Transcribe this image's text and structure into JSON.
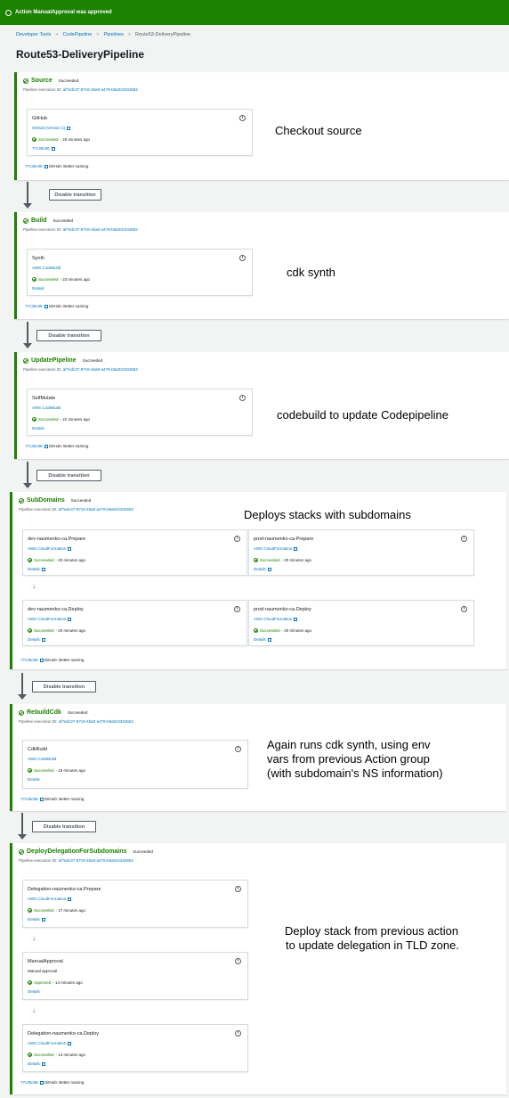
{
  "flash": {
    "text": "Action ManualApproval was approved"
  },
  "breadcrumb": [
    "Developer Tools",
    "CodePipeline",
    "Pipelines",
    "Route53-DeliveryPipeline"
  ],
  "page_title": "Route53-DeliveryPipeline",
  "common": {
    "exec_label": "Pipeline execution ID:",
    "exec_id": "af7edc37-87c8-4ba0-a478-b5a0cb334652",
    "commit_hash": "77c35c88",
    "commit_msg": "GitHub: Better naming",
    "disable_transition": "Disable transition",
    "details": "Details"
  },
  "stages": {
    "source": {
      "name": "Source",
      "status": "Succeeded",
      "action": {
        "name": "GitHub",
        "provider": "GitHub (Version 1)",
        "status": "Succeeded",
        "time": "- 25 minutes ago",
        "link": "77c35c88"
      }
    },
    "build": {
      "name": "Build",
      "status": "Succeeded",
      "action": {
        "name": "Synth",
        "provider": "AWS CodeBuild",
        "status": "Succeeded",
        "time": "- 23 minutes ago"
      }
    },
    "update": {
      "name": "UpdatePipeline",
      "status": "Succeeded",
      "action": {
        "name": "SelfMutate",
        "provider": "AWS CodeBuild",
        "status": "Succeeded",
        "time": "- 22 minutes ago"
      }
    },
    "subdomains": {
      "name": "SubDomains",
      "status": "Succeeded",
      "actions": [
        {
          "name": "dev-naumenko-ca.Prepare",
          "provider": "AWS CloudFormation",
          "status": "Succeeded",
          "time": "- 20 minutes ago"
        },
        {
          "name": "prod-naumenko-ca.Prepare",
          "provider": "AWS CloudFormation",
          "status": "Succeeded",
          "time": "- 20 minutes ago"
        },
        {
          "name": "dev-naumenko-ca.Deploy",
          "provider": "AWS CloudFormation",
          "status": "Succeeded",
          "time": "- 20 minutes ago"
        },
        {
          "name": "prod-naumenko-ca.Deploy",
          "provider": "AWS CloudFormation",
          "status": "Succeeded",
          "time": "- 20 minutes ago"
        }
      ]
    },
    "rebuild": {
      "name": "RebuildCdk",
      "status": "Succeeded",
      "action": {
        "name": "CdkBuild",
        "provider": "AWS CodeBuild",
        "status": "Succeeded",
        "time": "- 19 minutes ago"
      }
    },
    "delegation": {
      "name": "DeployDelegationForSubdomains",
      "status": "Succeeded",
      "actions": [
        {
          "name": "Delegation-naumenko-ca.Prepare",
          "provider": "AWS CloudFormation",
          "status": "Succeeded",
          "time": "- 17 minutes ago"
        },
        {
          "name": "ManualApproval",
          "provider": "Manual approval",
          "status": "Approved",
          "time": "- 14 minutes ago"
        },
        {
          "name": "Delegation-naumenko-ca.Deploy",
          "provider": "AWS CloudFormation",
          "status": "Succeeded",
          "time": "- 14 minutes ago"
        }
      ]
    }
  },
  "notes": {
    "source": "Checkout source",
    "build": "cdk synth",
    "update": "codebuild to update Codepipeline",
    "subdomains": "Deploys stacks with subdomains",
    "rebuild": [
      "Again runs cdk synth, using env",
      "vars from previous Action group",
      "(with subdomain's NS information)"
    ],
    "delegation": [
      "Deploy stack from previous action",
      "to update delegation in TLD zone."
    ]
  },
  "colors": {
    "success": "#1d8102",
    "link": "#0073bb",
    "flash_bg": "#1d8102"
  }
}
